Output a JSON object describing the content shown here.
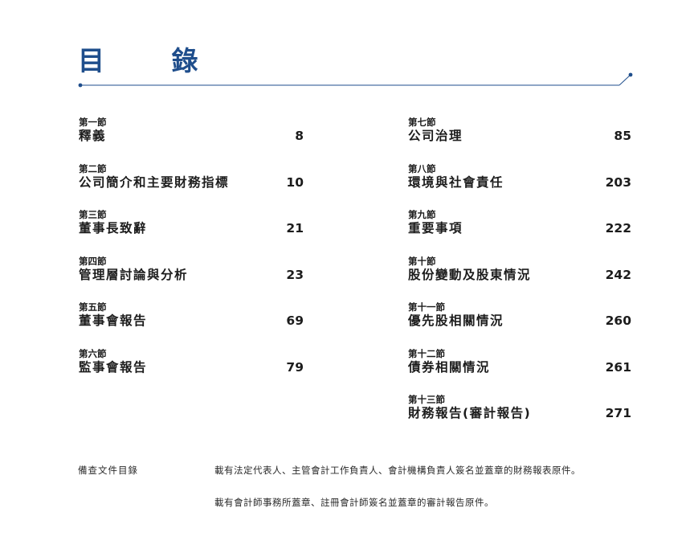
{
  "header": {
    "title": "目 錄",
    "accent_color": "#1f4e8c"
  },
  "toc": {
    "left": [
      {
        "section": "第一節",
        "name": "釋義",
        "page": "8"
      },
      {
        "section": "第二節",
        "name": "公司簡介和主要財務指標",
        "page": "10"
      },
      {
        "section": "第三節",
        "name": "董事長致辭",
        "page": "21"
      },
      {
        "section": "第四節",
        "name": "管理層討論與分析",
        "page": "23"
      },
      {
        "section": "第五節",
        "name": "董事會報告",
        "page": "69"
      },
      {
        "section": "第六節",
        "name": "監事會報告",
        "page": "79"
      }
    ],
    "right": [
      {
        "section": "第七節",
        "name": "公司治理",
        "page": "85"
      },
      {
        "section": "第八節",
        "name": "環境與社會責任",
        "page": "203"
      },
      {
        "section": "第九節",
        "name": "重要事項",
        "page": "222"
      },
      {
        "section": "第十節",
        "name": "股份變動及股東情況",
        "page": "242"
      },
      {
        "section": "第十一節",
        "name": "優先股相關情況",
        "page": "260"
      },
      {
        "section": "第十二節",
        "name": "債券相關情況",
        "page": "261"
      },
      {
        "section": "第十三節",
        "name": "財務報告(審計報告)",
        "page": "271"
      }
    ]
  },
  "notes": {
    "label": "備查文件目錄",
    "lines": [
      "載有法定代表人、主管會計工作負責人、會計機構負責人簽名並蓋章的財務報表原件。",
      "載有會計師事務所蓋章、註冊會計師簽名並蓋章的審計報告原件。"
    ]
  }
}
